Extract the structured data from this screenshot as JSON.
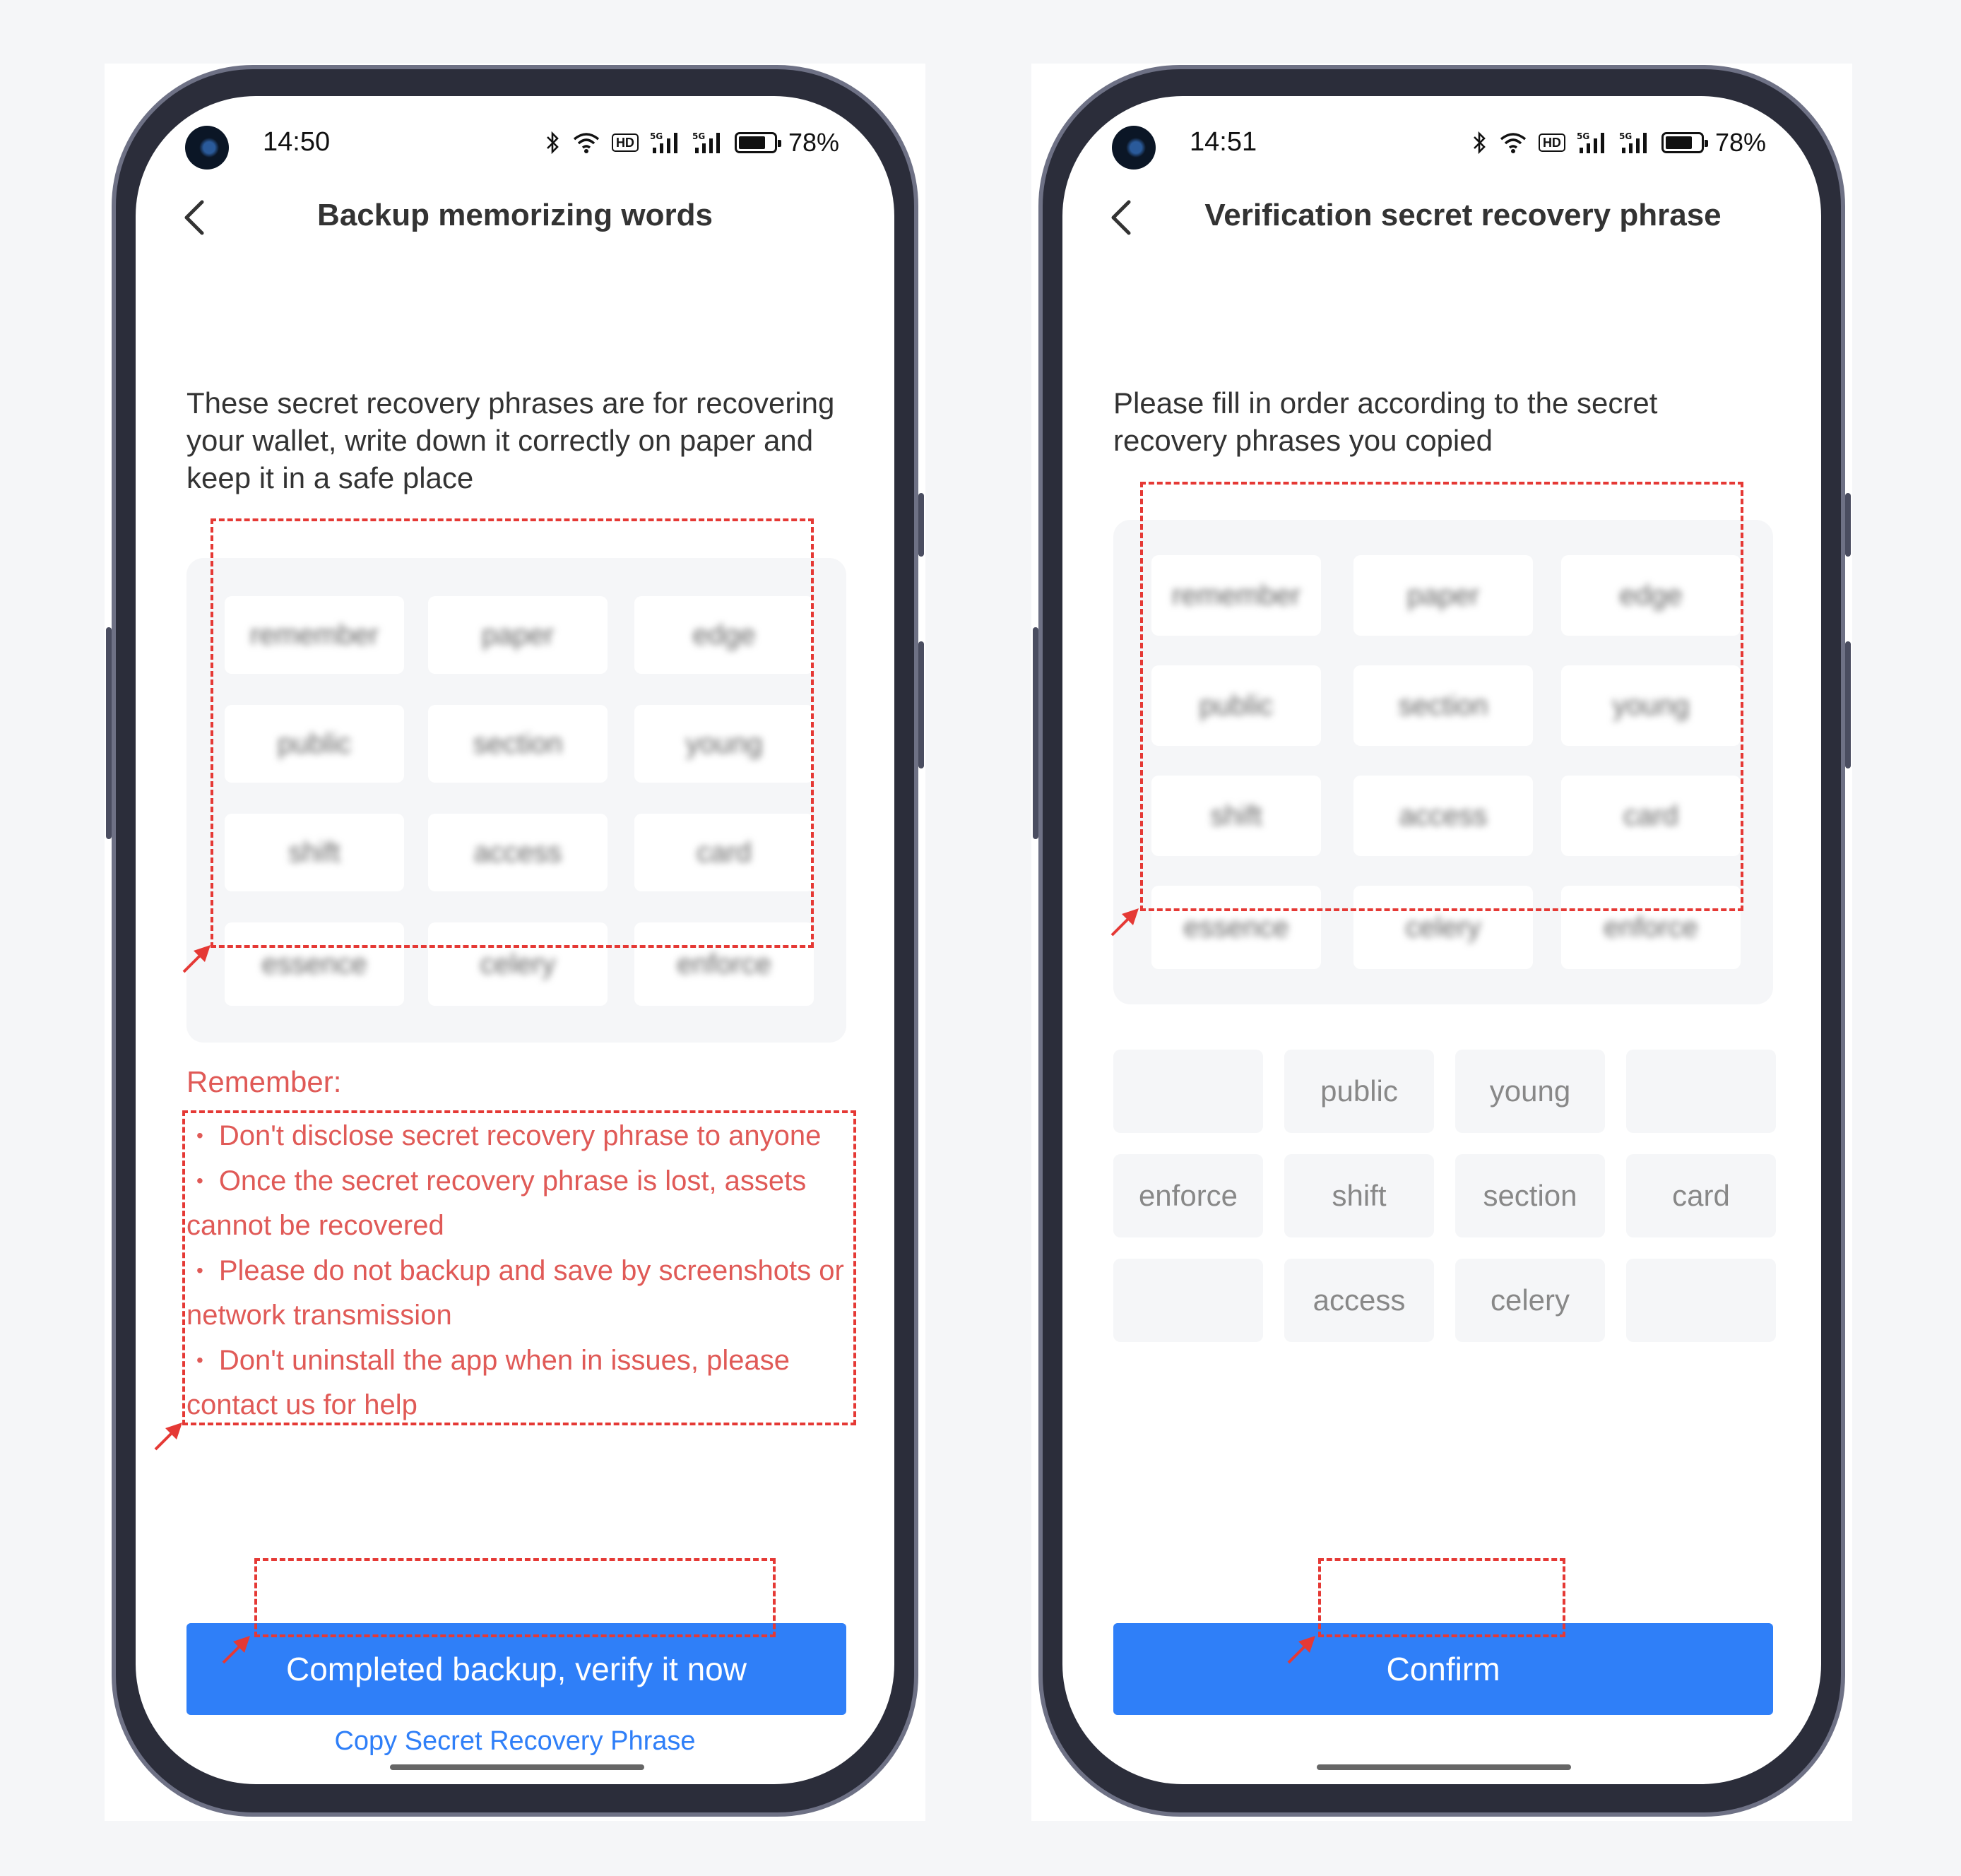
{
  "left": {
    "time": "14:50",
    "battery": "78%",
    "title": "Backup memorizing words",
    "description": "These secret recovery phrases are for recovering your wallet, write down it correctly on paper and keep it in a safe place",
    "words": [
      "remember",
      "paper",
      "edge",
      "public",
      "section",
      "young",
      "shift",
      "access",
      "card",
      "essence",
      "celery",
      "enforce"
    ],
    "remember_title": "Remember:",
    "remember_items": [
      "Don't disclose secret recovery phrase to anyone",
      "Once the secret recovery phrase is lost, assets cannot be recovered",
      "Please do not backup and save by screenshots or network transmission",
      "Don't uninstall the app when in issues, please contact us for help"
    ],
    "primary_button": "Completed backup, verify it now",
    "copy_link": "Copy Secret Recovery Phrase"
  },
  "right": {
    "time": "14:51",
    "battery": "78%",
    "title": "Verification secret recovery phrase",
    "description": "Please fill in order according to the secret recovery phrases you copied",
    "words": [
      "remember",
      "paper",
      "edge",
      "public",
      "section",
      "young",
      "shift",
      "access",
      "card",
      "essence",
      "celery",
      "enforce"
    ],
    "slots": [
      "",
      "public",
      "young",
      "",
      "enforce",
      "shift",
      "section",
      "card",
      "",
      "access",
      "celery",
      ""
    ],
    "primary_button": "Confirm"
  },
  "accent_color": "#2f7ff8",
  "warning_color": "#e05a57",
  "annotation_color": "#e53935"
}
